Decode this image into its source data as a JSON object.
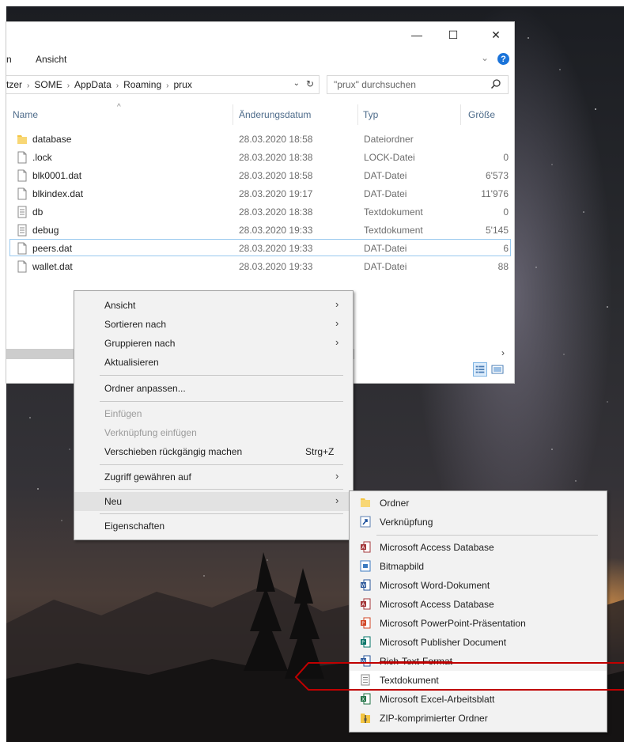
{
  "window": {
    "controls": {
      "minimize": "—",
      "maximize": "☐",
      "close": "✕"
    },
    "ribbon": {
      "tab_partial": "n",
      "tab_view": "Ansicht",
      "expand": "⌄",
      "help": "?"
    },
    "address": {
      "segments": [
        "tzer",
        "SOME",
        "AppData",
        "Roaming",
        "prux"
      ],
      "separator": "›",
      "dropdown": "⌄",
      "refresh": "↻"
    },
    "search": {
      "placeholder": "\"prux\" durchsuchen"
    },
    "columns": {
      "name": "Name",
      "date": "Änderungsdatum",
      "type": "Typ",
      "size": "Größe"
    },
    "files": [
      {
        "name": "database",
        "date": "28.03.2020 18:58",
        "type": "Dateiordner",
        "size": "",
        "icon": "folder-icon"
      },
      {
        "name": ".lock",
        "date": "28.03.2020 18:38",
        "type": "LOCK-Datei",
        "size": "0",
        "icon": "file-icon"
      },
      {
        "name": "blk0001.dat",
        "date": "28.03.2020 18:58",
        "type": "DAT-Datei",
        "size": "6'573",
        "icon": "file-icon"
      },
      {
        "name": "blkindex.dat",
        "date": "28.03.2020 19:17",
        "type": "DAT-Datei",
        "size": "11'976",
        "icon": "file-icon"
      },
      {
        "name": "db",
        "date": "28.03.2020 18:38",
        "type": "Textdokument",
        "size": "0",
        "icon": "text-file-icon"
      },
      {
        "name": "debug",
        "date": "28.03.2020 19:33",
        "type": "Textdokument",
        "size": "5'145",
        "icon": "text-file-icon"
      },
      {
        "name": "peers.dat",
        "date": "28.03.2020 19:33",
        "type": "DAT-Datei",
        "size": "6",
        "icon": "file-icon"
      },
      {
        "name": "wallet.dat",
        "date": "28.03.2020 19:33",
        "type": "DAT-Datei",
        "size": "88",
        "icon": "file-icon"
      }
    ],
    "scroll_right": "›"
  },
  "context_menu": {
    "items": [
      {
        "label": "Ansicht",
        "arrow": "›"
      },
      {
        "label": "Sortieren nach",
        "arrow": "›"
      },
      {
        "label": "Gruppieren nach",
        "arrow": "›"
      },
      {
        "label": "Aktualisieren"
      },
      {
        "label": "Ordner anpassen..."
      },
      {
        "label": "Einfügen"
      },
      {
        "label": "Verknüpfung einfügen"
      },
      {
        "label": "Verschieben rückgängig machen",
        "shortcut": "Strg+Z"
      },
      {
        "label": "Zugriff gewähren auf",
        "arrow": "›"
      },
      {
        "label": "Neu",
        "arrow": "›"
      },
      {
        "label": "Eigenschaften"
      }
    ]
  },
  "submenu_new": {
    "items": [
      {
        "label": "Ordner",
        "icon": "folder-icon"
      },
      {
        "label": "Verknüpfung",
        "icon": "shortcut-icon"
      },
      {
        "label": "Microsoft Access Database",
        "icon": "access-icon"
      },
      {
        "label": "Bitmapbild",
        "icon": "bitmap-icon"
      },
      {
        "label": "Microsoft Word-Dokument",
        "icon": "word-icon"
      },
      {
        "label": "Microsoft Access Database",
        "icon": "access-icon"
      },
      {
        "label": "Microsoft PowerPoint-Präsentation",
        "icon": "powerpoint-icon"
      },
      {
        "label": "Microsoft Publisher Document",
        "icon": "publisher-icon"
      },
      {
        "label": "Rich-Text-Format",
        "icon": "rtf-icon"
      },
      {
        "label": "Textdokument",
        "icon": "text-file-icon"
      },
      {
        "label": "Microsoft Excel-Arbeitsblatt",
        "icon": "excel-icon"
      },
      {
        "label": "ZIP-komprimierter Ordner",
        "icon": "zip-folder-icon"
      }
    ]
  },
  "colors": {
    "accent_blue": "#1a73d9",
    "header_text": "#4d6b8a",
    "annotation_red": "#c00000",
    "menu_bg": "#f2f2f2"
  }
}
